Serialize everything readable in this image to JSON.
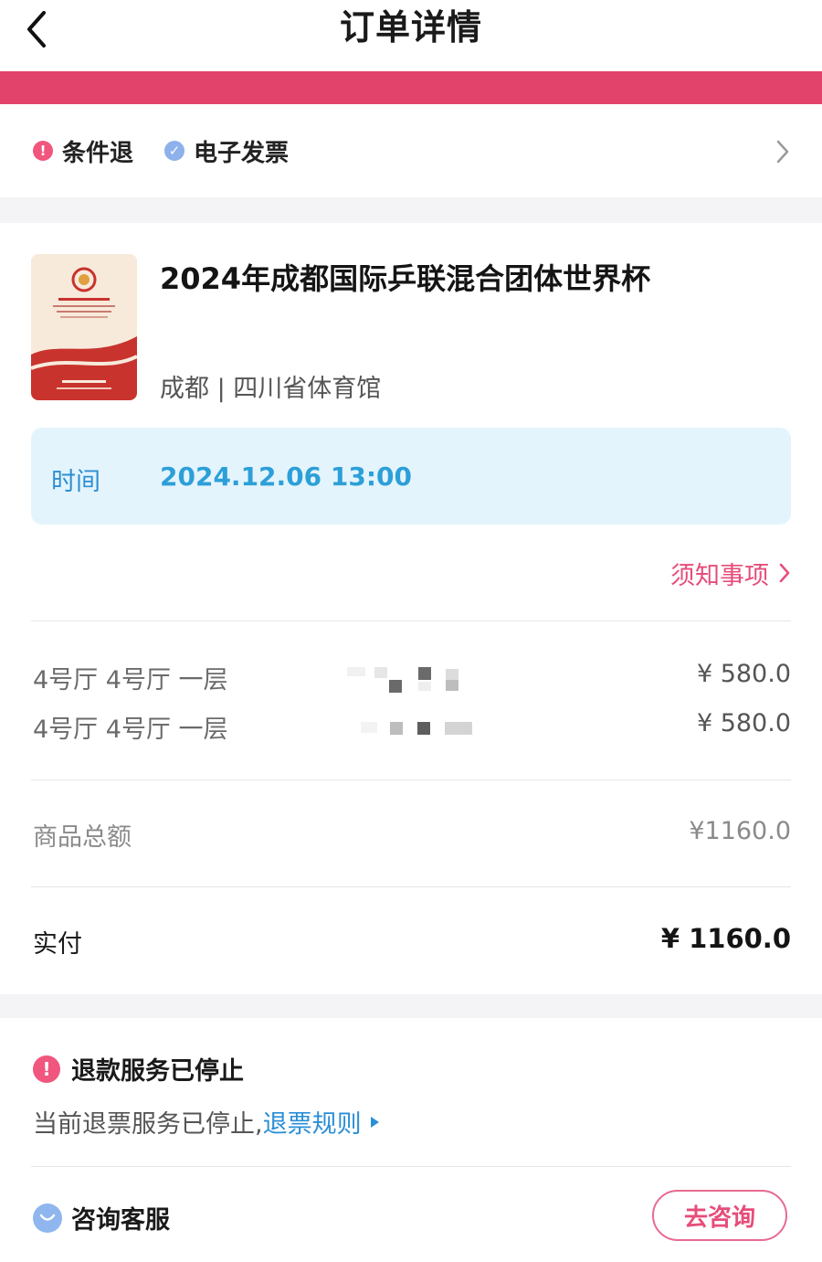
{
  "header": {
    "title": "订单详情",
    "back_icon": "chevron-left-icon"
  },
  "status_bar_color": "#e2436a",
  "service_tags": [
    {
      "label": "条件退",
      "icon": "exclamation-icon",
      "color": "#f0567e"
    },
    {
      "label": "电子发票",
      "icon": "check-badge-icon",
      "color": "#7fa9e8"
    }
  ],
  "event": {
    "title": "2024年成都国际乒联混合团体世界杯",
    "venue": "成都 | 四川省体育馆"
  },
  "time": {
    "label": "时间",
    "value": "2024.12.06 13:00"
  },
  "notice_link": "须知事项",
  "tickets": [
    {
      "name": "4号厅 4号厅  一层",
      "price": "¥ 580.0"
    },
    {
      "name": "4号厅 4号厅  一层",
      "price": "¥ 580.0"
    }
  ],
  "summary": {
    "subtotal_label": "商品总额",
    "subtotal_value": "¥1160.0",
    "paid_label": "实付",
    "paid_value": "¥ 1160.0"
  },
  "refund": {
    "title": "退款服务已停止",
    "desc": "当前退票服务已停止,",
    "link": "退票规则"
  },
  "consult": {
    "label": "咨询客服",
    "button": "去咨询"
  },
  "colors": {
    "accent": "#e64d7a",
    "link_blue": "#2a8fd6",
    "time_bg": "#e4f4fc"
  }
}
